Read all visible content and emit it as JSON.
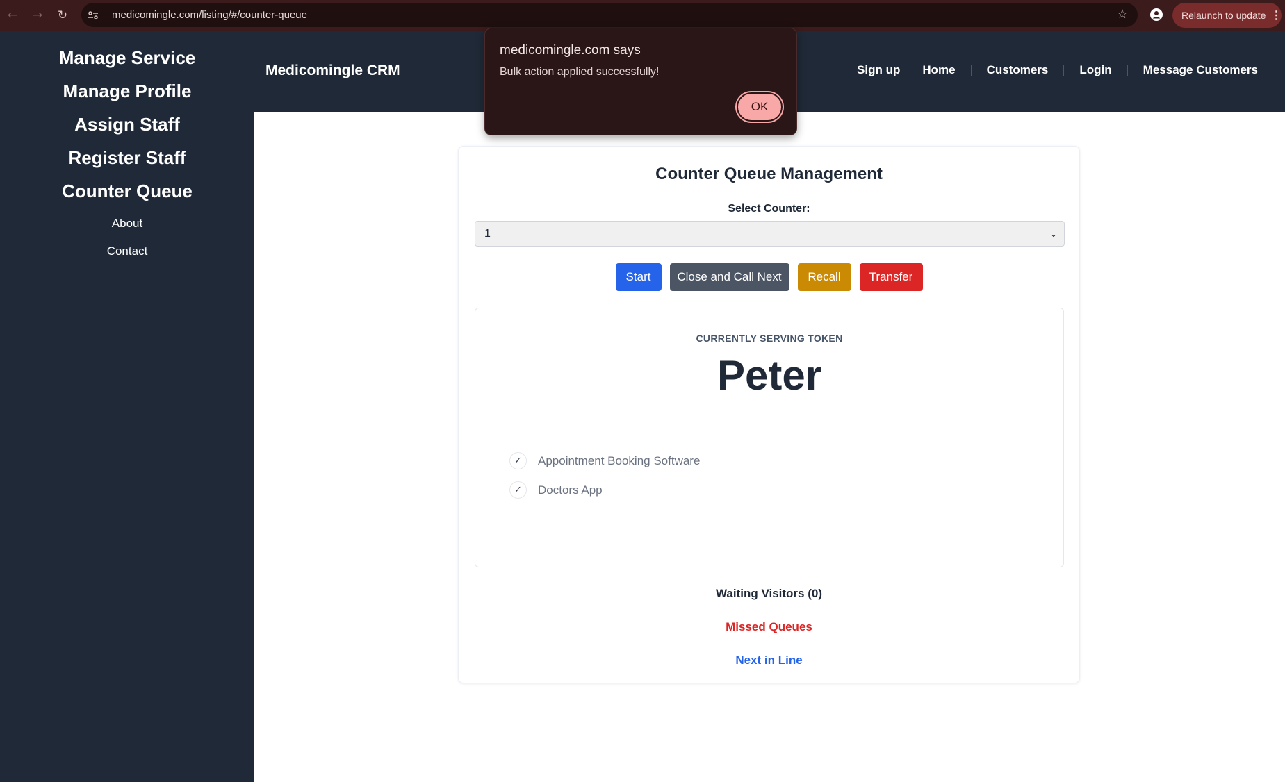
{
  "browser": {
    "url": "medicomingle.com/listing/#/counter-queue",
    "relaunch_label": "Relaunch to update",
    "back_icon": "←",
    "forward_icon": "→",
    "reload_icon": "↻",
    "star_icon": "☆",
    "menu_icon": "⋮"
  },
  "sidebar": {
    "items": [
      {
        "label": "Manage Service"
      },
      {
        "label": "Manage Profile"
      },
      {
        "label": "Assign Staff"
      },
      {
        "label": "Register Staff"
      },
      {
        "label": "Counter Queue"
      },
      {
        "label": "About"
      },
      {
        "label": "Contact"
      }
    ]
  },
  "header": {
    "brand": "Medicomingle CRM",
    "nav": [
      "Sign up",
      "Home",
      "Customers",
      "Login",
      "Message Customers"
    ]
  },
  "main": {
    "title": "Counter Queue Management",
    "select_label": "Select Counter:",
    "select_value": "1",
    "buttons": {
      "start": "Start",
      "close_call_next": "Close and Call Next",
      "recall": "Recall",
      "transfer": "Transfer"
    },
    "serving": {
      "label": "CURRENTLY SERVING TOKEN",
      "name": "Peter",
      "services": [
        "Appointment Booking Software",
        "Doctors App"
      ]
    },
    "waiting_visitors": "Waiting Visitors (0)",
    "missed_queues": "Missed Queues",
    "next_in_line": "Next in Line"
  },
  "alert": {
    "title": "medicomingle.com says",
    "message": "Bulk action applied successfully!",
    "ok_label": "OK"
  },
  "colors": {
    "sidebar_bg": "#1f2937",
    "start": "#2563eb",
    "close_call_next": "#4b5563",
    "recall": "#ca8a04",
    "transfer": "#dc2626",
    "missed": "#dc2626",
    "next": "#2563eb"
  }
}
